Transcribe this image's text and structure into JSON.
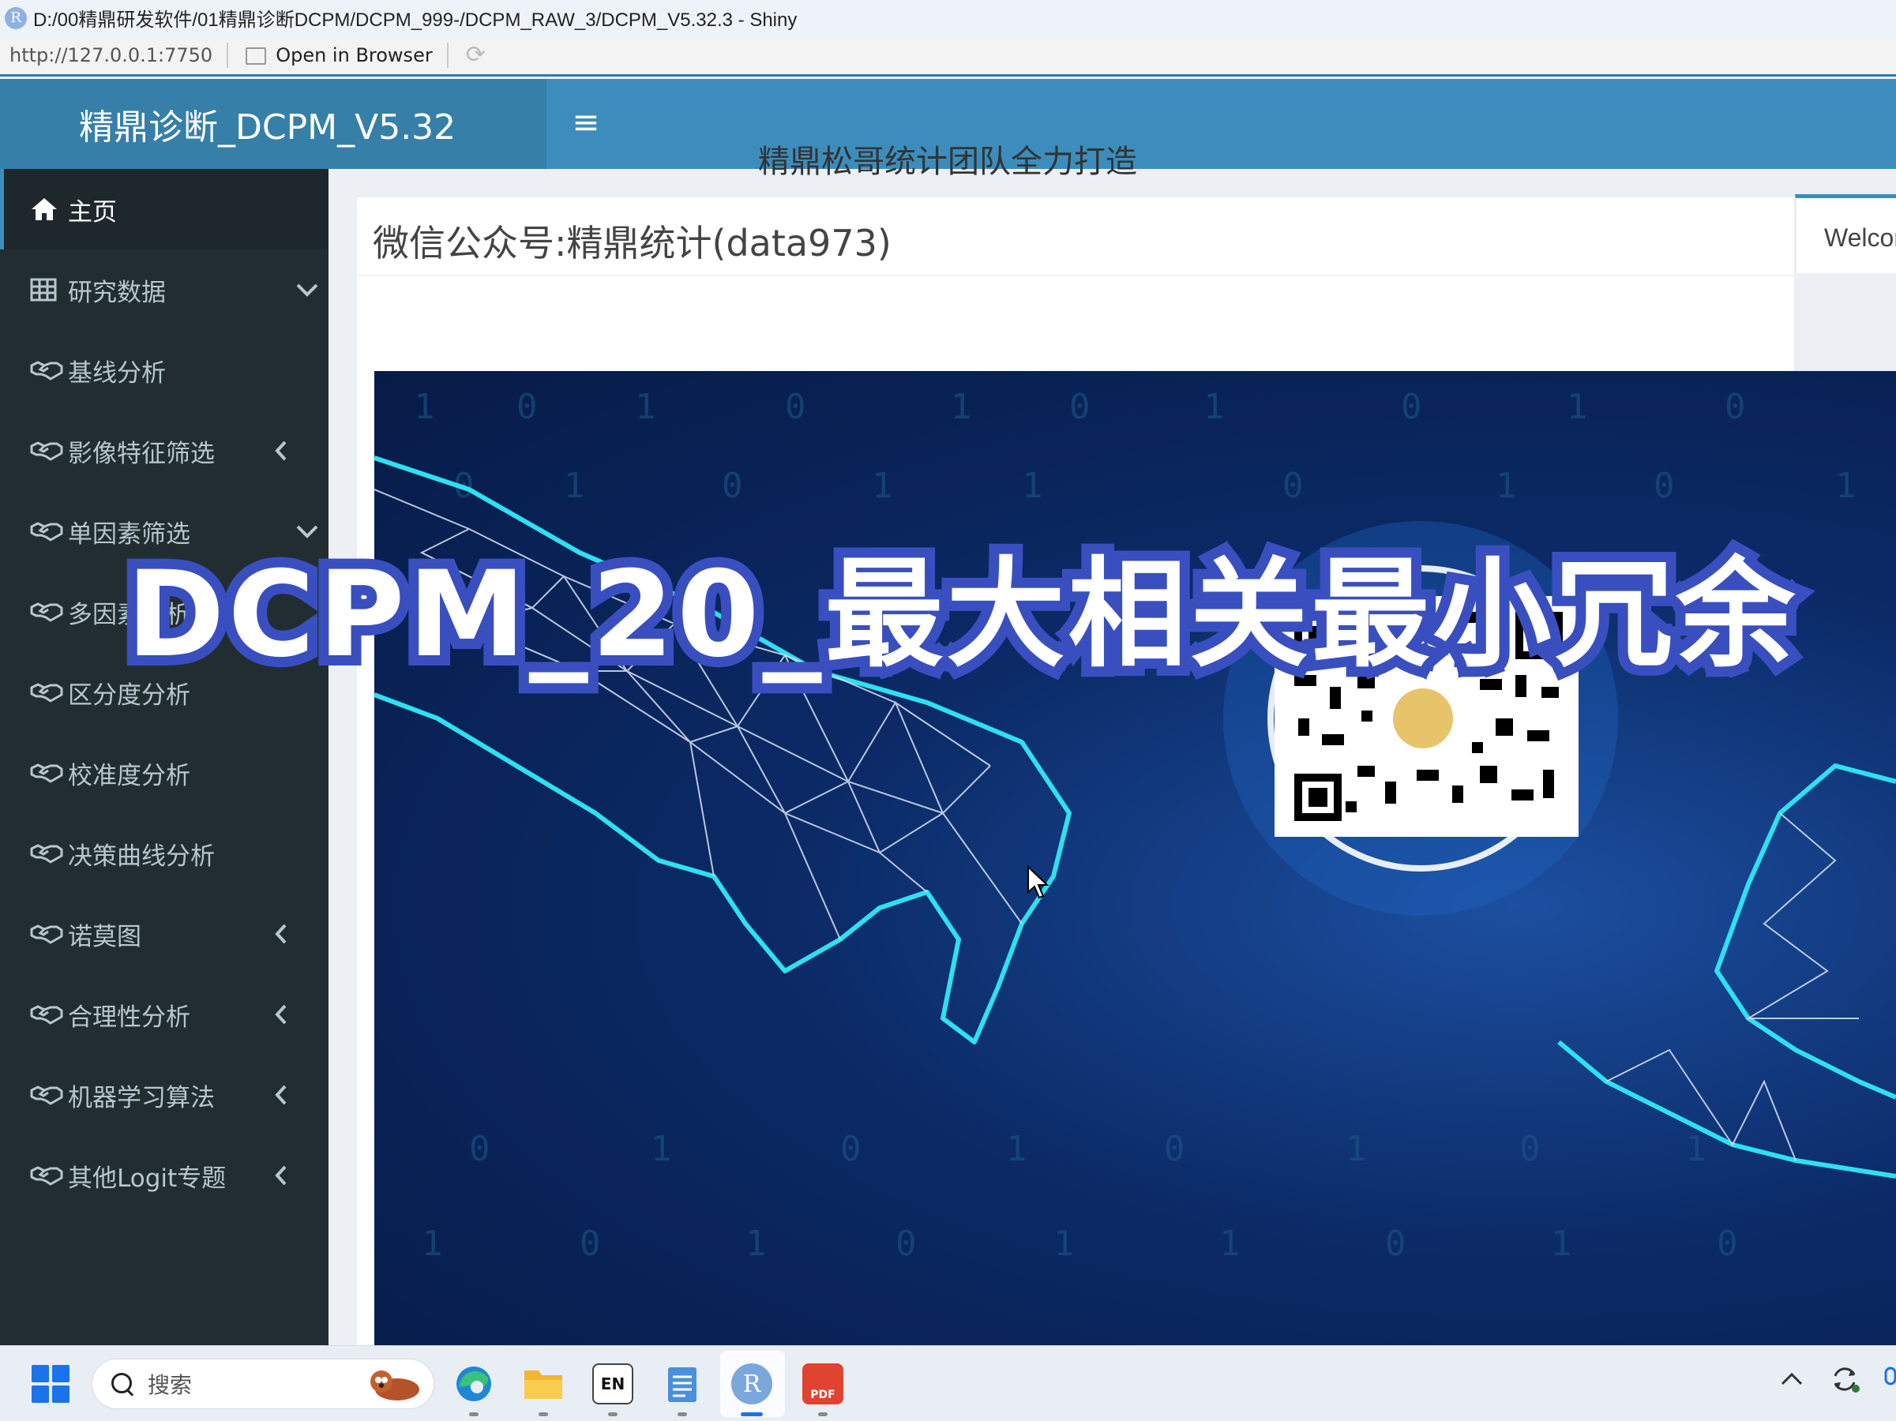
{
  "window": {
    "badge": "R",
    "title": "D:/00精鼎研发软件/01精鼎诊断DCPM/DCPM_999-/DCPM_RAW_3/DCPM_V5.32.3 - Shiny"
  },
  "addressbar": {
    "url": "http://127.0.0.1:7750",
    "open_label": "Open in Browser"
  },
  "header": {
    "logo": "精鼎诊断_DCPM_V5.32",
    "menu_toggle": "≡"
  },
  "sidebar": {
    "items": [
      {
        "label": "主页",
        "icon": "home-icon",
        "caret": ""
      },
      {
        "label": "研究数据",
        "icon": "table-icon",
        "caret": "down"
      },
      {
        "label": "基线分析",
        "icon": "handshake-icon",
        "caret": ""
      },
      {
        "label": "影像特征筛选",
        "icon": "handshake-icon",
        "caret": "left"
      },
      {
        "label": "单因素筛选",
        "icon": "handshake-icon",
        "caret": "down"
      },
      {
        "label": "多因素分析",
        "icon": "handshake-icon",
        "caret": ""
      },
      {
        "label": "区分度分析",
        "icon": "handshake-icon",
        "caret": ""
      },
      {
        "label": "校准度分析",
        "icon": "handshake-icon",
        "caret": ""
      },
      {
        "label": "决策曲线分析",
        "icon": "handshake-icon",
        "caret": ""
      },
      {
        "label": "诺莫图",
        "icon": "handshake-icon",
        "caret": "left"
      },
      {
        "label": "合理性分析",
        "icon": "handshake-icon",
        "caret": "left"
      },
      {
        "label": "机器学习算法",
        "icon": "handshake-icon",
        "caret": "left"
      },
      {
        "label": "其他Logit专题",
        "icon": "handshake-icon",
        "caret": "left"
      }
    ]
  },
  "main": {
    "box_title": "微信公众号:精鼎统计(data973)",
    "welcome_tab": "Welcome",
    "subtitle": "精鼎松哥统计团队全力打造"
  },
  "overlay": {
    "title": "DCPM_20_最大相关最小冗余"
  },
  "taskbar": {
    "search_placeholder": "搜索",
    "ime_label": "EN",
    "r_label": "R",
    "pdf_label": "PDF"
  },
  "colors": {
    "header": "#3c8dbc",
    "logo_bg": "#367fa9",
    "sidebar": "#222d32",
    "overlay_fill": "#3a4fbf",
    "banner": "#0b2a66"
  }
}
